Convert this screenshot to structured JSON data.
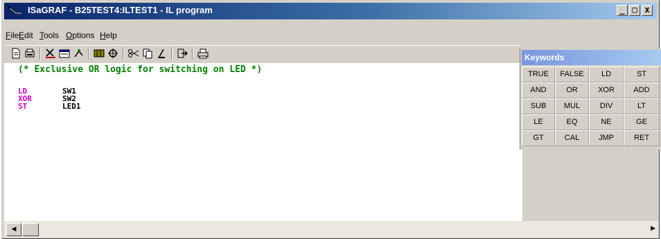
{
  "window": {
    "title": "ISaGRAF - B25TEST4:ILTEST1 - IL program",
    "minimize": "_",
    "maximize": "□",
    "close": "x"
  },
  "menu": [
    {
      "label": "File",
      "name": "menu-file"
    },
    {
      "label": "Edit",
      "name": "menu-edit"
    },
    {
      "label": "Tools",
      "name": "menu-tools"
    },
    {
      "label": "Options",
      "name": "menu-options"
    },
    {
      "label": "Help",
      "name": "menu-help"
    }
  ],
  "toolbar_icons": [
    "new-icon",
    "print-preview-icon",
    "cut-variable-icon",
    "dictionary-icon",
    "tools-icon",
    "grid-icon",
    "link-icon",
    "scissors-icon",
    "copy-icon",
    "brush-icon",
    "exit-icon",
    "print-icon"
  ],
  "editor": {
    "comment": "(* Exclusive OR logic for switching on LED *)",
    "lines": [
      {
        "op": "LD",
        "arg": "SW1"
      },
      {
        "op": "XOR",
        "arg": "SW2"
      },
      {
        "op": "ST",
        "arg": "LED1"
      }
    ]
  },
  "scrollbar": {
    "left_arrow": "◀",
    "right_arrow": "▶"
  },
  "keywords_panel": {
    "title": "Keywords",
    "close": "×",
    "items": [
      "TRUE",
      "FALSE",
      "LD",
      "ST",
      "AND",
      "OR",
      "XOR",
      "ADD",
      "SUB",
      "MUL",
      "DIV",
      "LT",
      "LE",
      "EQ",
      "NE",
      "GE",
      "GT",
      "CAL",
      "JMP",
      "RET"
    ]
  },
  "colors": {
    "titlebar_start": "#0a246a",
    "comment": "#008000",
    "keyword": "#cc00cc",
    "panel_title": "#7a96df"
  }
}
